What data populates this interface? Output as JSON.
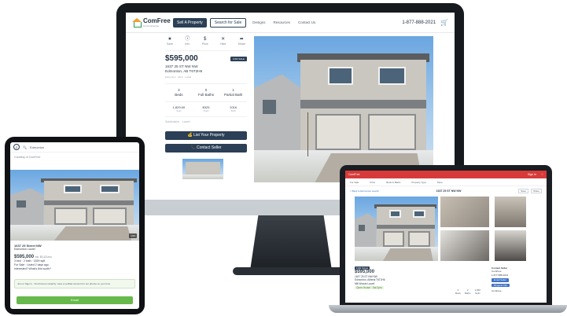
{
  "desktop": {
    "logo": {
      "brand": "ComFree",
      "tagline": "Commonsense"
    },
    "header": {
      "sell_button": "Sell A Property",
      "search_button": "Search for Sale",
      "nav": [
        "Designs",
        "Resources",
        "Contact Us"
      ],
      "phone": "1-877-888-2021"
    },
    "icons": [
      {
        "icon": "star-icon",
        "label": "Save"
      },
      {
        "icon": "info-icon",
        "label": "Info"
      },
      {
        "icon": "dollar-icon",
        "label": "Price"
      },
      {
        "icon": "close-icon",
        "label": "Hide"
      },
      {
        "icon": "share-icon",
        "label": "Share"
      }
    ],
    "listing": {
      "price": "$595,000",
      "badge": "FOR SALE",
      "address_line1": "1637 25 ST NW NW",
      "address_line2": "Edmonton, AB T6T2H6",
      "meta": "Edmonton · MLS · Listed",
      "beds_value": "3",
      "beds_label": "Beds",
      "baths_value": "0",
      "baths_label": "Full Baths",
      "partial_value": "1",
      "partial_label": "Partial Bath",
      "sqft_value": "1,829.69",
      "sqft_unit": "SqFt",
      "ppsf_value": "$325",
      "ppsf_unit": "/SqFt",
      "year_value": "2016",
      "year_unit": "Built",
      "subdivision_label": "Subdivision",
      "subdivision_value": "Laurel",
      "cta_list": "List Your Property",
      "cta_contact": "Contact Seller",
      "photos_button": "Photos",
      "save_label": "Save"
    }
  },
  "tablet": {
    "search": "Edmonton",
    "courtesy": "Courtesy of ComFree",
    "photo_count": "1/33",
    "address": "1637 25 Street NW",
    "neighbourhood": "Edmonton Laurel",
    "price": "$595,000",
    "price_sub": "est. $3,421/mo",
    "beds_baths": "3 bed · 2 bath · 1829 sqft",
    "for_sale": "For Sale · Listed 2 days ago",
    "interested": "Interested? What's this worth?",
    "notice": "Join or Sign in · Find homes instantly: save a verified account for our photos on your time",
    "email_button": "Email"
  },
  "laptop": {
    "topbar_left": "ComFree",
    "topbar_right": "Sign In",
    "filters": [
      "For Sale",
      "Price",
      "Beds & Baths",
      "Property Type",
      "More"
    ],
    "back_link": "< Back to Edmonton search",
    "address_head": "1637 25 ST NW NW",
    "actions": [
      "Save",
      "Share"
    ],
    "price_badge": "FOR SALE",
    "price": "$595,000",
    "address_line1": "1637 25 ST NW NW",
    "address_line2": "Edmonton, Alberta T6T2H6",
    "address_line3": "Mill Woods Laurel",
    "green_tag": "Open House · Sat 2pm",
    "stats": [
      {
        "value": "3",
        "label": "Beds"
      },
      {
        "value": "2",
        "label": "Baths"
      },
      {
        "value": "1,830",
        "label": "SqFt"
      }
    ],
    "side_title": "Contact Seller",
    "side_sub": "ComFree",
    "side_phone": "1-877-888-2021",
    "side_button": "Email Seller",
    "side_button2": "Request Info",
    "side_footer": "ComFree"
  }
}
